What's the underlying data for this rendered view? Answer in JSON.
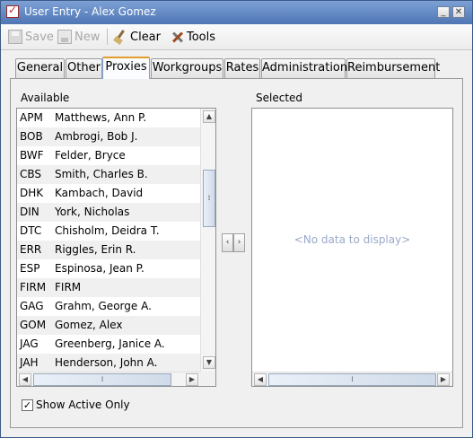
{
  "window": {
    "title": "User Entry - Alex Gomez",
    "minimize_glyph": "_",
    "close_glyph": "✕"
  },
  "toolbar": {
    "save_label": "Save",
    "new_label": "New",
    "clear_label": "Clear",
    "tools_label": "Tools"
  },
  "tabs": [
    {
      "label": "General"
    },
    {
      "label": "Other"
    },
    {
      "label": "Proxies"
    },
    {
      "label": "Workgroups"
    },
    {
      "label": "Rates"
    },
    {
      "label": "Administration"
    },
    {
      "label": "Reimbursement"
    }
  ],
  "proxies": {
    "available_label": "Available",
    "selected_label": "Selected",
    "available": [
      {
        "code": "APM",
        "name": "Matthews, Ann P."
      },
      {
        "code": "BOB",
        "name": "Ambrogi, Bob J."
      },
      {
        "code": "BWF",
        "name": "Felder, Bryce"
      },
      {
        "code": "CBS",
        "name": "Smith, Charles B."
      },
      {
        "code": "DHK",
        "name": "Kambach, David"
      },
      {
        "code": "DIN",
        "name": "York, Nicholas"
      },
      {
        "code": "DTC",
        "name": "Chisholm, Deidra T."
      },
      {
        "code": "ERR",
        "name": "Riggles, Erin R."
      },
      {
        "code": "ESP",
        "name": "Espinosa, Jean P."
      },
      {
        "code": "FIRM",
        "name": "FIRM"
      },
      {
        "code": "GAG",
        "name": "Grahm, George A."
      },
      {
        "code": "GOM",
        "name": "Gomez, Alex"
      },
      {
        "code": "JAG",
        "name": "Greenberg, Janice A."
      },
      {
        "code": "JAH",
        "name": "Henderson, John A."
      }
    ],
    "selected_empty_text": "<No data to display>",
    "move_left_glyph": "‹",
    "move_right_glyph": "›",
    "show_active_only_label": "Show Active Only",
    "show_active_only_checked": true,
    "check_glyph": "✓"
  }
}
